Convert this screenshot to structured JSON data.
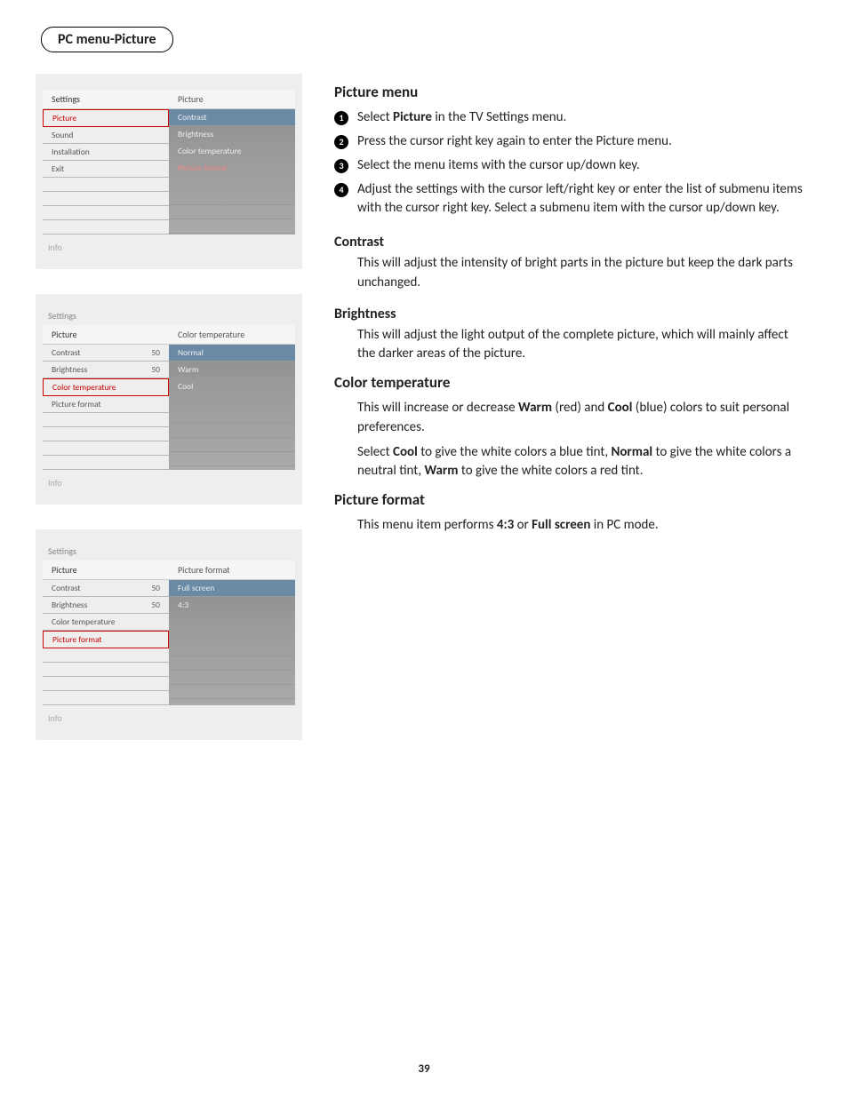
{
  "page": {
    "title": "PC menu-Picture",
    "number": "39"
  },
  "menushot1": {
    "settings": "Settings",
    "leftHeader": "Settings",
    "rightHeader": "Picture",
    "left": [
      {
        "label": "Picture",
        "selected": true
      },
      {
        "label": "Sound"
      },
      {
        "label": "Installation"
      },
      {
        "label": "Exit"
      }
    ],
    "right": [
      {
        "label": "Contrast"
      },
      {
        "label": "Brightness"
      },
      {
        "label": "Color temperature"
      },
      {
        "label": "Picture format"
      }
    ],
    "info": "Info"
  },
  "menushot2": {
    "settings": "Settings",
    "leftHeader": "Picture",
    "rightHeader": "Color temperature",
    "left": [
      {
        "label": "Contrast",
        "val": "50"
      },
      {
        "label": "Brightness",
        "val": "50"
      },
      {
        "label": "Color temperature",
        "selected": true
      },
      {
        "label": "Picture format"
      }
    ],
    "right": [
      {
        "label": "Normal"
      },
      {
        "label": "Warm"
      },
      {
        "label": "Cool"
      }
    ],
    "info": "Info"
  },
  "menushot3": {
    "settings": "Settings",
    "leftHeader": "Picture",
    "rightHeader": "Picture format",
    "left": [
      {
        "label": "Contrast",
        "val": "50"
      },
      {
        "label": "Brightness",
        "val": "50"
      },
      {
        "label": "Color temperature"
      },
      {
        "label": "Picture format",
        "selected": true
      }
    ],
    "right": [
      {
        "label": "Full screen"
      },
      {
        "label": "4:3"
      }
    ],
    "info": "Info"
  },
  "text": {
    "pm_title": "Picture menu",
    "step1a": "Select ",
    "step1b": "Picture",
    "step1c": " in the TV Settings menu.",
    "step2": "Press the cursor right key again to enter the Picture menu.",
    "step3": "Select the menu items with the cursor up/down key.",
    "step4": "Adjust the settings with the cursor left/right key or enter the list of submenu items with the cursor right key. Select a submenu item with the cursor up/down key.",
    "contrast_t": "Contrast",
    "contrast_b": "This will adjust the intensity of bright parts in the picture but keep the dark parts unchanged.",
    "bright_t": "Brightness",
    "bright_b": "This will adjust the light output of the complete picture, which will mainly affect the darker areas of the picture.",
    "ct_t": "Color temperature",
    "ct_b1a": "This will increase or decrease ",
    "ct_b1b": "Warm",
    "ct_b1c": " (red) and ",
    "ct_b1d": "Cool",
    "ct_b1e": " (blue) colors to suit personal preferences.",
    "ct_b2a": "Select ",
    "ct_b2b": "Cool",
    "ct_b2c": " to give the white colors a blue tint, ",
    "ct_b2d": "Normal",
    "ct_b2e": " to give the white colors a neutral tint, ",
    "ct_b2f": "Warm",
    "ct_b2g": " to give the white colors a red tint.",
    "pf_t": "Picture format",
    "pf_b1a": "This menu item performs ",
    "pf_b1b": "4:3",
    "pf_b1c": " or ",
    "pf_b1d": "Full screen",
    "pf_b1e": " in PC mode."
  }
}
